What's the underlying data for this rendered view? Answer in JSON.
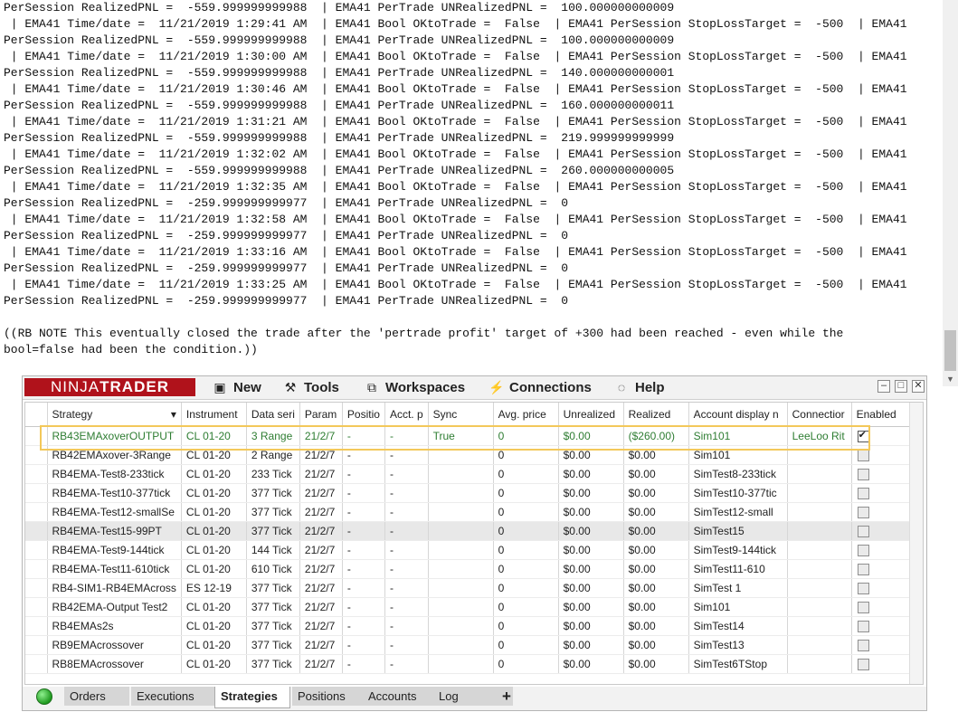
{
  "log_lines": [
    "PerSession RealizedPNL =  -559.999999999988  | EMA41 PerTrade UNRealizedPNL =  100.000000000009",
    " | EMA41 Time/date =  11/21/2019 1:29:41 AM  | EMA41 Bool OKtoTrade =  False  | EMA41 PerSession StopLossTarget =  -500  | EMA41",
    "PerSession RealizedPNL =  -559.999999999988  | EMA41 PerTrade UNRealizedPNL =  100.000000000009",
    " | EMA41 Time/date =  11/21/2019 1:30:00 AM  | EMA41 Bool OKtoTrade =  False  | EMA41 PerSession StopLossTarget =  -500  | EMA41",
    "PerSession RealizedPNL =  -559.999999999988  | EMA41 PerTrade UNRealizedPNL =  140.000000000001",
    " | EMA41 Time/date =  11/21/2019 1:30:46 AM  | EMA41 Bool OKtoTrade =  False  | EMA41 PerSession StopLossTarget =  -500  | EMA41",
    "PerSession RealizedPNL =  -559.999999999988  | EMA41 PerTrade UNRealizedPNL =  160.000000000011",
    " | EMA41 Time/date =  11/21/2019 1:31:21 AM  | EMA41 Bool OKtoTrade =  False  | EMA41 PerSession StopLossTarget =  -500  | EMA41",
    "PerSession RealizedPNL =  -559.999999999988  | EMA41 PerTrade UNRealizedPNL =  219.999999999999",
    " | EMA41 Time/date =  11/21/2019 1:32:02 AM  | EMA41 Bool OKtoTrade =  False  | EMA41 PerSession StopLossTarget =  -500  | EMA41",
    "PerSession RealizedPNL =  -559.999999999988  | EMA41 PerTrade UNRealizedPNL =  260.000000000005",
    " | EMA41 Time/date =  11/21/2019 1:32:35 AM  | EMA41 Bool OKtoTrade =  False  | EMA41 PerSession StopLossTarget =  -500  | EMA41",
    "PerSession RealizedPNL =  -259.999999999977  | EMA41 PerTrade UNRealizedPNL =  0",
    " | EMA41 Time/date =  11/21/2019 1:32:58 AM  | EMA41 Bool OKtoTrade =  False  | EMA41 PerSession StopLossTarget =  -500  | EMA41",
    "PerSession RealizedPNL =  -259.999999999977  | EMA41 PerTrade UNRealizedPNL =  0",
    " | EMA41 Time/date =  11/21/2019 1:33:16 AM  | EMA41 Bool OKtoTrade =  False  | EMA41 PerSession StopLossTarget =  -500  | EMA41",
    "PerSession RealizedPNL =  -259.999999999977  | EMA41 PerTrade UNRealizedPNL =  0",
    " | EMA41 Time/date =  11/21/2019 1:33:25 AM  | EMA41 Bool OKtoTrade =  False  | EMA41 PerSession StopLossTarget =  -500  | EMA41",
    "PerSession RealizedPNL =  -259.999999999977  | EMA41 PerTrade UNRealizedPNL =  0",
    "",
    "((RB NOTE This eventually closed the trade after the 'pertrade profit' target of +300 had been reached - even while the",
    "bool=false had been the condition.))"
  ],
  "app": {
    "logo_left": "NINJA",
    "logo_right": "TRADER",
    "menu": [
      {
        "label": "New",
        "icon": "new-window-icon",
        "glyph": "▣"
      },
      {
        "label": "Tools",
        "icon": "tools-icon",
        "glyph": "⚒"
      },
      {
        "label": "Workspaces",
        "icon": "workspaces-icon",
        "glyph": "⧉"
      },
      {
        "label": "Connections",
        "icon": "plug-icon",
        "glyph": "⚡"
      },
      {
        "label": "Help",
        "icon": "help-icon",
        "glyph": "◌"
      }
    ],
    "window_buttons": {
      "minimize": "–",
      "maximize": "□",
      "close": "✕"
    }
  },
  "grid": {
    "columns": [
      "Strategy",
      "Instrument",
      "Data seri",
      "Param",
      "Positio",
      "Acct. p",
      "Sync",
      "Avg. price",
      "Unrealized",
      "Realized",
      "Account display n",
      "Connectior",
      "Enabled"
    ],
    "sort_indicator": "▾",
    "rows": [
      [
        "RB43EMAxoverOUTPUT",
        "CL 01-20",
        "3 Range",
        "21/2/7",
        "-",
        "-",
        "True",
        "0",
        "$0.00",
        "($260.00)",
        "Sim101",
        "LeeLoo Rit",
        "checked"
      ],
      [
        "RB42EMAxover-3Range",
        "CL 01-20",
        "2 Range",
        "21/2/7",
        "-",
        "-",
        "",
        "0",
        "$0.00",
        "$0.00",
        "Sim101",
        "",
        "unchecked"
      ],
      [
        "RB4EMA-Test8-233tick",
        "CL 01-20",
        "233 Tick",
        "21/2/7",
        "-",
        "-",
        "",
        "0",
        "$0.00",
        "$0.00",
        "SimTest8-233tick",
        "",
        "unchecked"
      ],
      [
        "RB4EMA-Test10-377tick",
        "CL 01-20",
        "377 Tick",
        "21/2/7",
        "-",
        "-",
        "",
        "0",
        "$0.00",
        "$0.00",
        "SimTest10-377tic",
        "",
        "unchecked"
      ],
      [
        "RB4EMA-Test12-smallSe",
        "CL 01-20",
        "377 Tick",
        "21/2/7",
        "-",
        "-",
        "",
        "0",
        "$0.00",
        "$0.00",
        "SimTest12-small",
        "",
        "unchecked"
      ],
      [
        "RB4EMA-Test15-99PT",
        "CL 01-20",
        "377 Tick",
        "21/2/7",
        "-",
        "-",
        "",
        "0",
        "$0.00",
        "$0.00",
        "SimTest15",
        "",
        "unchecked"
      ],
      [
        "RB4EMA-Test9-144tick",
        "CL 01-20",
        "144 Tick",
        "21/2/7",
        "-",
        "-",
        "",
        "0",
        "$0.00",
        "$0.00",
        "SimTest9-144tick",
        "",
        "unchecked"
      ],
      [
        "RB4EMA-Test11-610tick",
        "CL 01-20",
        "610 Tick",
        "21/2/7",
        "-",
        "-",
        "",
        "0",
        "$0.00",
        "$0.00",
        "SimTest11-610",
        "",
        "unchecked"
      ],
      [
        "RB4-SIM1-RB4EMAcross",
        "ES 12-19",
        "377 Tick",
        "21/2/7",
        "-",
        "-",
        "",
        "0",
        "$0.00",
        "$0.00",
        "SimTest 1",
        "",
        "unchecked"
      ],
      [
        "RB42EMA-Output Test2",
        "CL 01-20",
        "377 Tick",
        "21/2/7",
        "-",
        "-",
        "",
        "0",
        "$0.00",
        "$0.00",
        "Sim101",
        "",
        "unchecked"
      ],
      [
        "RB4EMAs2s",
        "CL 01-20",
        "377 Tick",
        "21/2/7",
        "-",
        "-",
        "",
        "0",
        "$0.00",
        "$0.00",
        "SimTest14",
        "",
        "unchecked"
      ],
      [
        "RB9EMAcrossover",
        "CL 01-20",
        "377 Tick",
        "21/2/7",
        "-",
        "-",
        "",
        "0",
        "$0.00",
        "$0.00",
        "SimTest13",
        "",
        "unchecked"
      ],
      [
        "RB8EMAcrossover",
        "CL 01-20",
        "377 Tick",
        "21/2/7",
        "-",
        "-",
        "",
        "0",
        "$0.00",
        "$0.00",
        "SimTest6TStop",
        "",
        "unchecked"
      ]
    ],
    "selected_row": 0,
    "alt_row": 5
  },
  "tabs": [
    "Orders",
    "Executions",
    "Strategies",
    "Positions",
    "Accounts",
    "Log",
    "+"
  ],
  "active_tab": "Strategies",
  "colors": {
    "logo_bg": "#b0121b",
    "selected_text": "#2e7d32",
    "highlight": "#f3c85a"
  }
}
